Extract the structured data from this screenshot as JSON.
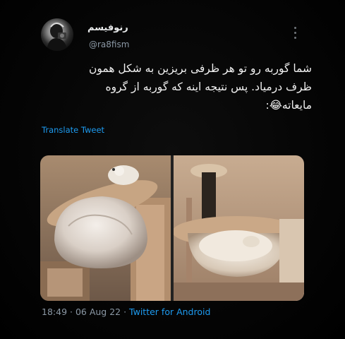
{
  "tweet": {
    "display_name": "رنوفیسم",
    "handle": "@ra8fism",
    "text_lines": [
      "شما گوربه رو تو هر ظرفی بریزین به شکل همون",
      "ظرف درمیاد. پس نتیجه اینه که گوربه از گروه",
      "مایعاته😂:"
    ],
    "translate_label": "Translate Tweet",
    "time": "18:49",
    "separator": " · ",
    "date": "06 Aug 22",
    "source": "Twitter for Android"
  },
  "icons": {
    "more": "more-options-icon",
    "avatar": "profile-avatar"
  },
  "colors": {
    "background": "#000000",
    "text": "#e7e9ea",
    "muted": "#8b98a5",
    "link": "#1d9bf0"
  }
}
